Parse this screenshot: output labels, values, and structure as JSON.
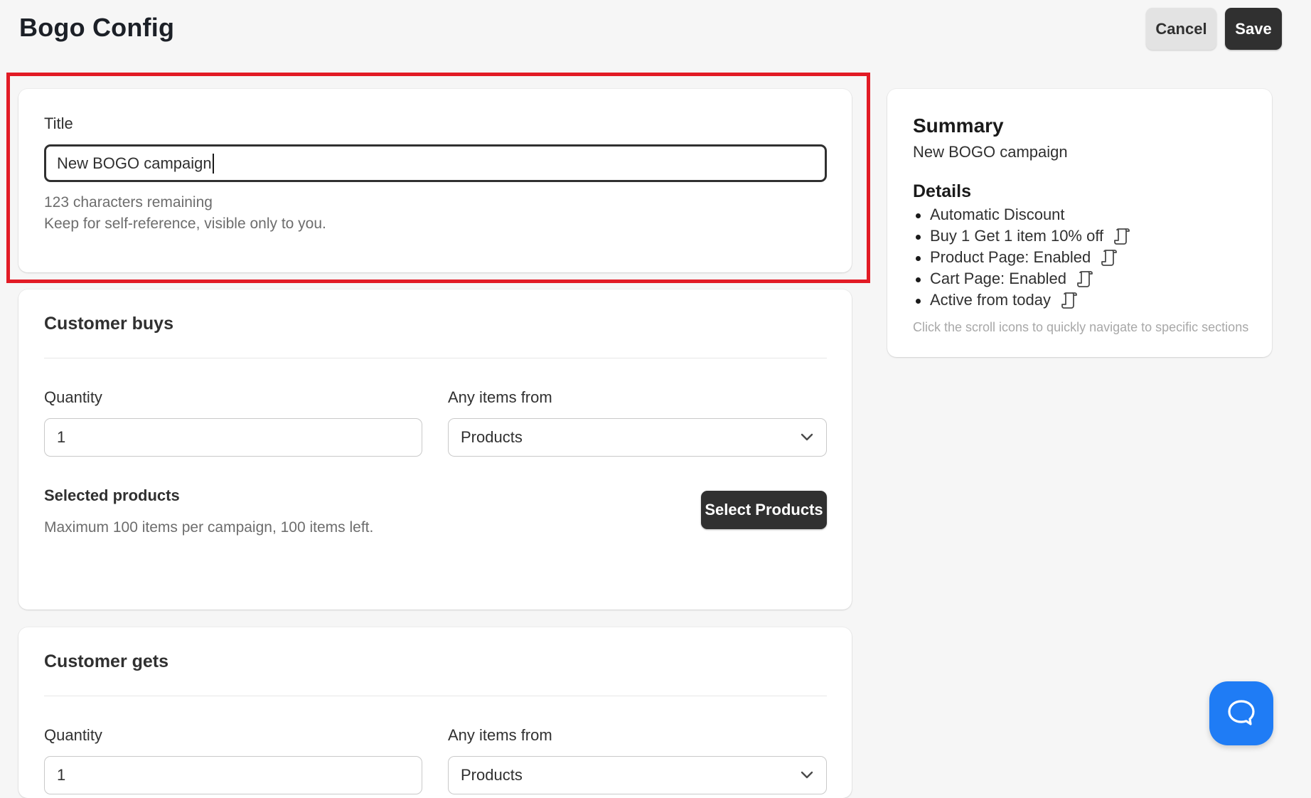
{
  "header": {
    "title": "Bogo Config",
    "cancel_label": "Cancel",
    "save_label": "Save"
  },
  "title_card": {
    "label": "Title",
    "value": "New BOGO campaign",
    "chars_remaining": "123 characters remaining",
    "help_text": "Keep for self-reference, visible only to you."
  },
  "customer_buys": {
    "heading": "Customer buys",
    "quantity_label": "Quantity",
    "quantity_value": "1",
    "items_from_label": "Any items from",
    "items_from_value": "Products",
    "selected_products_label": "Selected products",
    "selected_products_help": "Maximum 100 items per campaign, 100 items left.",
    "select_button_label": "Select Products"
  },
  "customer_gets": {
    "heading": "Customer gets",
    "quantity_label": "Quantity",
    "quantity_value": "1",
    "items_from_label": "Any items from",
    "items_from_value": "Products"
  },
  "summary": {
    "heading": "Summary",
    "campaign_name": "New BOGO campaign",
    "details_heading": "Details",
    "details": [
      {
        "text": "Automatic Discount",
        "icon": null
      },
      {
        "text": "Buy 1 Get 1 item 10% off",
        "icon": "scroll-icon"
      },
      {
        "text": "Product Page: Enabled",
        "icon": "scroll-icon"
      },
      {
        "text": "Cart Page: Enabled",
        "icon": "scroll-icon"
      },
      {
        "text": "Active from today",
        "icon": "scroll-icon"
      }
    ],
    "hint": "Click the scroll icons to quickly navigate to specific sections"
  },
  "chat": {
    "icon": "chat-bubble-icon"
  },
  "colors": {
    "highlight": "#e21b25",
    "primary_button": "#303030",
    "chat_button": "#1f7cf5",
    "page_background": "#f6f6f6"
  }
}
